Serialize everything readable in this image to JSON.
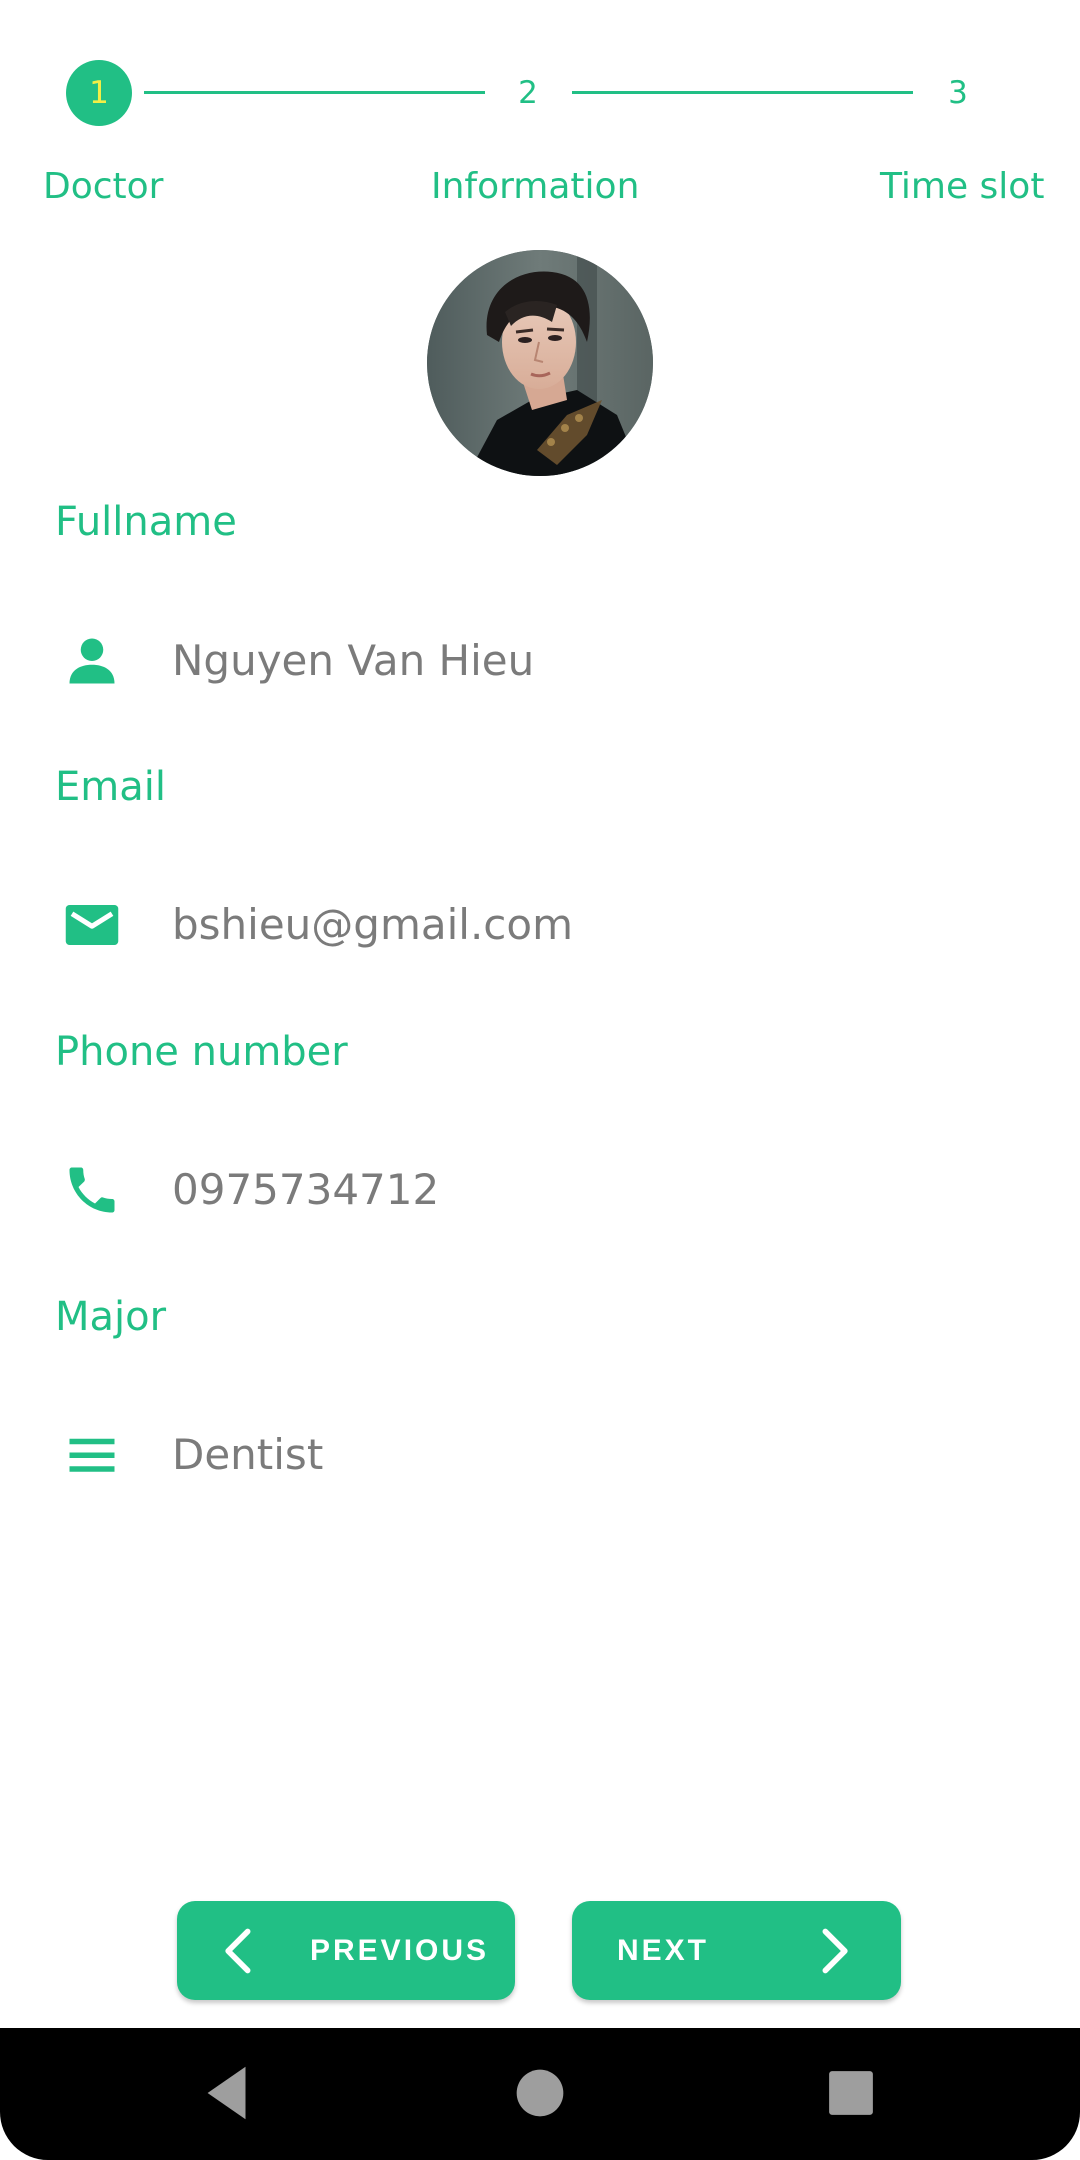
{
  "stepper": {
    "steps": [
      {
        "number": "1",
        "label": "Doctor",
        "active": true
      },
      {
        "number": "2",
        "label": "Information",
        "active": false
      },
      {
        "number": "3",
        "label": "Time slot",
        "active": false
      }
    ]
  },
  "profile": {
    "fields": [
      {
        "label": "Fullname",
        "value": "Nguyen Van Hieu",
        "icon": "person-icon"
      },
      {
        "label": "Email",
        "value": "bshieu@gmail.com",
        "icon": "mail-icon"
      },
      {
        "label": "Phone number",
        "value": "0975734712",
        "icon": "phone-icon"
      },
      {
        "label": "Major",
        "value": "Dentist",
        "icon": "menu-lines-icon"
      }
    ]
  },
  "actions": {
    "previous_label": "PREVIOUS",
    "next_label": "NEXT"
  },
  "system_nav": {
    "icons": [
      "back-icon",
      "home-icon",
      "recents-icon"
    ]
  },
  "colors": {
    "accent": "#21bf85",
    "active_step_number": "#f3ee46",
    "value_text": "#7b7b7b",
    "nav_bar": "#000000"
  }
}
